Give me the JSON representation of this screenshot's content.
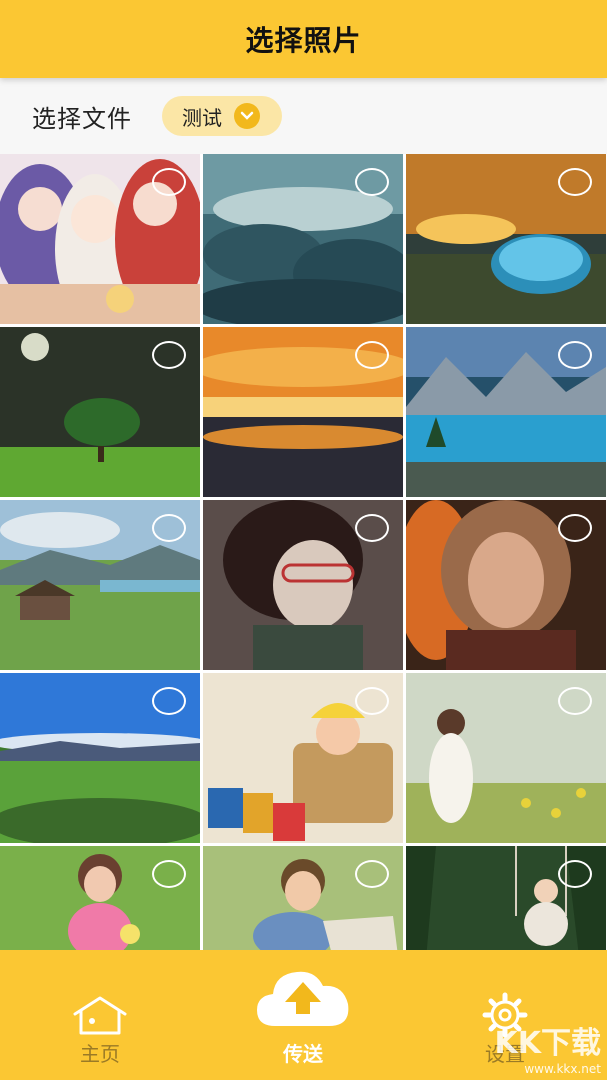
{
  "header": {
    "title": "选择照片"
  },
  "filter": {
    "label": "选择文件",
    "folder_value": "测试"
  },
  "photos": [
    {
      "subject": "anime characters group"
    },
    {
      "subject": "clouds sky"
    },
    {
      "subject": "bottle landscape sunset"
    },
    {
      "subject": "lone tree under moon"
    },
    {
      "subject": "sunset over lake"
    },
    {
      "subject": "mountain lake"
    },
    {
      "subject": "meadow with hut"
    },
    {
      "subject": "anime boy with glasses"
    },
    {
      "subject": "painted woman portrait"
    },
    {
      "subject": "green field blue sky"
    },
    {
      "subject": "baby in basket"
    },
    {
      "subject": "woman in flower field"
    },
    {
      "subject": "girl with flowers"
    },
    {
      "subject": "smiling boy with map"
    },
    {
      "subject": "child on swing in forest"
    }
  ],
  "bottom_nav": {
    "home_label": "主页",
    "send_label": "传送",
    "settings_label": "设置"
  },
  "watermark": {
    "logo": "KK下载",
    "url": "www.kkx.net"
  },
  "colors": {
    "accent": "#fbc733",
    "chevron_bg": "#f2b81c",
    "pill_bg": "#fbe6a6"
  }
}
